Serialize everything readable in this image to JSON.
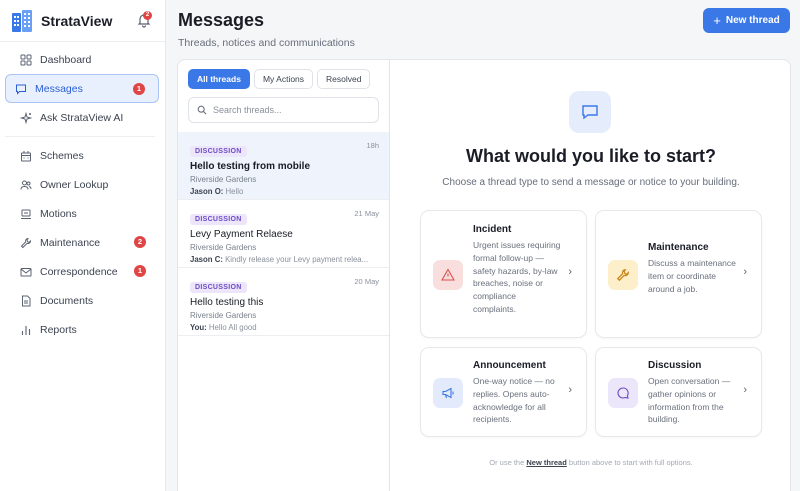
{
  "app": {
    "name": "StrataView",
    "notifications": "2"
  },
  "sidebar": {
    "items": [
      {
        "label": "Dashboard",
        "icon": "dashboard-icon"
      },
      {
        "label": "Messages",
        "icon": "message-icon",
        "badge": "1"
      },
      {
        "label": "Ask StrataView AI",
        "icon": "sparkle-icon"
      },
      {
        "label": "Schemes",
        "icon": "building-icon"
      },
      {
        "label": "Owner Lookup",
        "icon": "users-icon"
      },
      {
        "label": "Motions",
        "icon": "gavel-icon"
      },
      {
        "label": "Maintenance",
        "icon": "wrench-icon",
        "badge": "2"
      },
      {
        "label": "Correspondence",
        "icon": "mail-icon",
        "badge": "1"
      },
      {
        "label": "Documents",
        "icon": "document-icon"
      },
      {
        "label": "Reports",
        "icon": "bar-chart-icon"
      }
    ]
  },
  "header": {
    "title": "Messages",
    "subtitle": "Threads, notices and communications",
    "new_thread_label": "New thread"
  },
  "threads_panel": {
    "tabs": [
      "All threads",
      "My Actions",
      "Resolved"
    ],
    "search_placeholder": "Search threads...",
    "threads": [
      {
        "tag": "DISCUSSION",
        "date": "18h",
        "title": "Hello testing from mobile",
        "place": "Riverside Gardens",
        "author": "Jason O:",
        "preview": "Hello"
      },
      {
        "tag": "DISCUSSION",
        "date": "21 May",
        "title": "Levy Payment Relaese",
        "place": "Riverside Gardens",
        "author": "Jason C:",
        "preview": "Kindly release your Levy payment relea..."
      },
      {
        "tag": "DISCUSSION",
        "date": "20 May",
        "title": "Hello testing this",
        "place": "Riverside Gardens",
        "author": "You:",
        "preview": "Hello All good"
      }
    ]
  },
  "start": {
    "title": "What would you like to start?",
    "subtitle": "Choose a thread type to send a message or notice to your building.",
    "cards": [
      {
        "title": "Incident",
        "desc": "Urgent issues requiring formal follow-up — safety hazards, by-law breaches, noise or compliance complaints.",
        "icon": "warning-icon",
        "color": "#f9dede",
        "icon_color": "#d9534f"
      },
      {
        "title": "Maintenance",
        "desc": "Discuss a maintenance item or coordinate around a job.",
        "icon": "wrench-icon",
        "color": "#fcefc9",
        "icon_color": "#c9871d"
      },
      {
        "title": "Announcement",
        "desc": "One-way notice — no replies. Opens auto-acknowledge for all recipients.",
        "icon": "megaphone-icon",
        "color": "#e2eafb",
        "icon_color": "#3b78e7"
      },
      {
        "title": "Discussion",
        "desc": "Open conversation — gather opinions or information from the building.",
        "icon": "chat-bubble-icon",
        "color": "#ece6fa",
        "icon_color": "#6b4bc4"
      }
    ],
    "footer_before": "Or use the",
    "footer_link": "New thread",
    "footer_after": "button above to start with full options."
  }
}
